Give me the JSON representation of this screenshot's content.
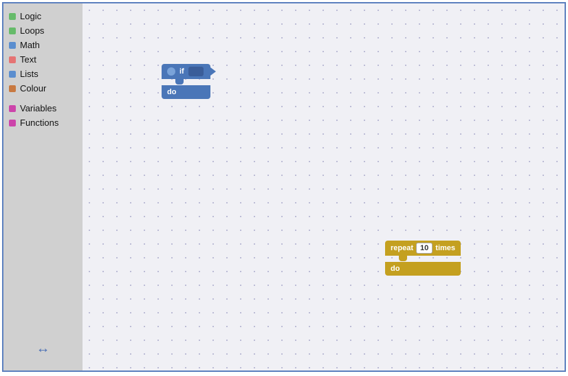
{
  "sidebar": {
    "items": [
      {
        "id": "logic",
        "label": "Logic",
        "color": "#66bb6a"
      },
      {
        "id": "loops",
        "label": "Loops",
        "color": "#66bb6a"
      },
      {
        "id": "math",
        "label": "Math",
        "color": "#5b8ecf"
      },
      {
        "id": "text",
        "label": "Text",
        "color": "#e57373"
      },
      {
        "id": "lists",
        "label": "Lists",
        "color": "#5b8ecf"
      },
      {
        "id": "colour",
        "label": "Colour",
        "color": "#c87941"
      }
    ],
    "items2": [
      {
        "id": "variables",
        "label": "Variables",
        "color": "#cc44aa"
      },
      {
        "id": "functions",
        "label": "Functions",
        "color": "#cc44aa"
      }
    ],
    "resize_icon": "↔"
  },
  "blocks": {
    "if_block": {
      "top_label": "if",
      "bottom_label": "do"
    },
    "repeat_block": {
      "top_label_prefix": "repeat",
      "number_value": "10",
      "top_label_suffix": "times",
      "bottom_label": "do"
    }
  }
}
